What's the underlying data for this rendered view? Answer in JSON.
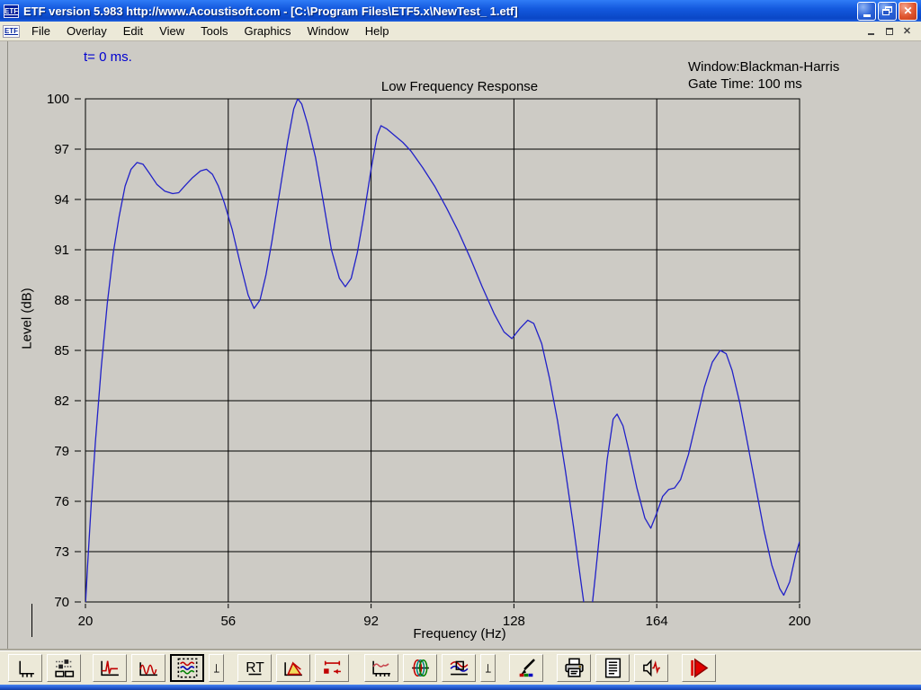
{
  "window": {
    "title": "ETF version 5.983 http://www.Acoustisoft.com - [C:\\Program Files\\ETF5.x\\NewTest_ 1.etf]",
    "app_icon_label": "ETF"
  },
  "menu": {
    "icon_label": "ETF",
    "items": [
      "File",
      "Overlay",
      "Edit",
      "View",
      "Tools",
      "Graphics",
      "Window",
      "Help"
    ]
  },
  "chart_data": {
    "type": "line",
    "title": "Low Frequency Response",
    "xlabel": "Frequency (Hz)",
    "ylabel": "Level (dB)",
    "xlim": [
      20,
      200
    ],
    "ylim": [
      70,
      100
    ],
    "xticks": [
      20,
      56,
      92,
      128,
      164,
      200
    ],
    "yticks": [
      100,
      97,
      94,
      91,
      88,
      85,
      82,
      79,
      76,
      73,
      70
    ],
    "grid": true,
    "annotations": {
      "time_label": "t= 0 ms.",
      "window_label": "Window:Blackman-Harris",
      "gate_label": "Gate Time: 100 ms"
    },
    "series": [
      {
        "name": "low-frequency-response",
        "color": "#2121C8",
        "points": [
          [
            20,
            69.8
          ],
          [
            20.5,
            72
          ],
          [
            21.5,
            76
          ],
          [
            22.5,
            79.5
          ],
          [
            24,
            84
          ],
          [
            25.5,
            87.8
          ],
          [
            27,
            90.8
          ],
          [
            28.5,
            93
          ],
          [
            30,
            94.8
          ],
          [
            31.5,
            95.8
          ],
          [
            33,
            96.2
          ],
          [
            34.5,
            96.1
          ],
          [
            36,
            95.6
          ],
          [
            38,
            94.9
          ],
          [
            40,
            94.5
          ],
          [
            42,
            94.35
          ],
          [
            43.5,
            94.4
          ],
          [
            45,
            94.8
          ],
          [
            47,
            95.3
          ],
          [
            49,
            95.7
          ],
          [
            50.5,
            95.8
          ],
          [
            52,
            95.5
          ],
          [
            53.5,
            94.8
          ],
          [
            55,
            93.8
          ],
          [
            57,
            92.2
          ],
          [
            59,
            90.2
          ],
          [
            61,
            88.3
          ],
          [
            62.5,
            87.5
          ],
          [
            64,
            88
          ],
          [
            65.5,
            89.5
          ],
          [
            67,
            91.5
          ],
          [
            69,
            94.5
          ],
          [
            71,
            97.5
          ],
          [
            72.5,
            99.4
          ],
          [
            73.5,
            100
          ],
          [
            74.5,
            99.7
          ],
          [
            76,
            98.5
          ],
          [
            78,
            96.5
          ],
          [
            80,
            93.8
          ],
          [
            82,
            91
          ],
          [
            84,
            89.3
          ],
          [
            85.5,
            88.8
          ],
          [
            87,
            89.3
          ],
          [
            88.5,
            90.8
          ],
          [
            90,
            92.8
          ],
          [
            92,
            95.8
          ],
          [
            93.5,
            97.8
          ],
          [
            94.5,
            98.4
          ],
          [
            96,
            98.2
          ],
          [
            98,
            97.8
          ],
          [
            100,
            97.4
          ],
          [
            102,
            96.9
          ],
          [
            105,
            95.9
          ],
          [
            108,
            94.8
          ],
          [
            111,
            93.5
          ],
          [
            114,
            92.1
          ],
          [
            117,
            90.5
          ],
          [
            120,
            88.8
          ],
          [
            123,
            87.2
          ],
          [
            125.5,
            86.1
          ],
          [
            127.5,
            85.7
          ],
          [
            129.5,
            86.3
          ],
          [
            131.5,
            86.8
          ],
          [
            133,
            86.6
          ],
          [
            135,
            85.4
          ],
          [
            137,
            83.3
          ],
          [
            139,
            80.8
          ],
          [
            141,
            77.8
          ],
          [
            143,
            74.5
          ],
          [
            145,
            71
          ],
          [
            146,
            69.3
          ],
          [
            147.5,
            69.3
          ],
          [
            148.5,
            71.5
          ],
          [
            150,
            75
          ],
          [
            151.5,
            78.5
          ],
          [
            153,
            80.9
          ],
          [
            154,
            81.2
          ],
          [
            155.5,
            80.5
          ],
          [
            157,
            79
          ],
          [
            159,
            76.8
          ],
          [
            161,
            75
          ],
          [
            162.5,
            74.4
          ],
          [
            164,
            75.3
          ],
          [
            165.5,
            76.3
          ],
          [
            167,
            76.7
          ],
          [
            168.5,
            76.8
          ],
          [
            170,
            77.3
          ],
          [
            172,
            78.8
          ],
          [
            174,
            80.8
          ],
          [
            176,
            82.8
          ],
          [
            178,
            84.3
          ],
          [
            180,
            85
          ],
          [
            181.5,
            84.8
          ],
          [
            183,
            83.8
          ],
          [
            185,
            81.8
          ],
          [
            187,
            79.3
          ],
          [
            189,
            76.8
          ],
          [
            191,
            74.3
          ],
          [
            193,
            72.2
          ],
          [
            195,
            70.8
          ],
          [
            196,
            70.4
          ],
          [
            197.5,
            71.2
          ],
          [
            199,
            72.8
          ],
          [
            200,
            73.6
          ]
        ]
      }
    ]
  },
  "toolbar": {
    "buttons": [
      {
        "id": "graph-axes",
        "icon": "axes-icon"
      },
      {
        "id": "level-settings",
        "icon": "sliders-icon"
      },
      {
        "id": "impulse-response",
        "icon": "impulse-icon",
        "gap": 8
      },
      {
        "id": "sine-sweep",
        "icon": "sine-icon"
      },
      {
        "id": "frequency-response",
        "icon": "multicurve-icon",
        "selected": true
      },
      {
        "id": "corner-marker",
        "icon": "corner-axis-icon",
        "narrow": true
      },
      {
        "id": "rt60",
        "icon": "rt-icon",
        "label": "RT",
        "gap": 10
      },
      {
        "id": "waterfall",
        "icon": "waterfall-icon"
      },
      {
        "id": "gate-time",
        "icon": "gate-arrows-icon"
      },
      {
        "id": "smoothed-response",
        "icon": "smoothed-curve-icon",
        "gap": 12
      },
      {
        "id": "phase",
        "icon": "phase-loops-icon"
      },
      {
        "id": "overlay-compare",
        "icon": "overlay-icon"
      },
      {
        "id": "corner-marker-2",
        "icon": "corner-axis-icon",
        "narrow": true
      },
      {
        "id": "color-settings",
        "icon": "brush-icon",
        "gap": 10
      },
      {
        "id": "print",
        "icon": "printer-icon",
        "gap": 10
      },
      {
        "id": "report",
        "icon": "document-icon"
      },
      {
        "id": "speaker-test",
        "icon": "speaker-icon"
      },
      {
        "id": "run-measurement",
        "icon": "play-icon",
        "gap": 10
      }
    ]
  }
}
